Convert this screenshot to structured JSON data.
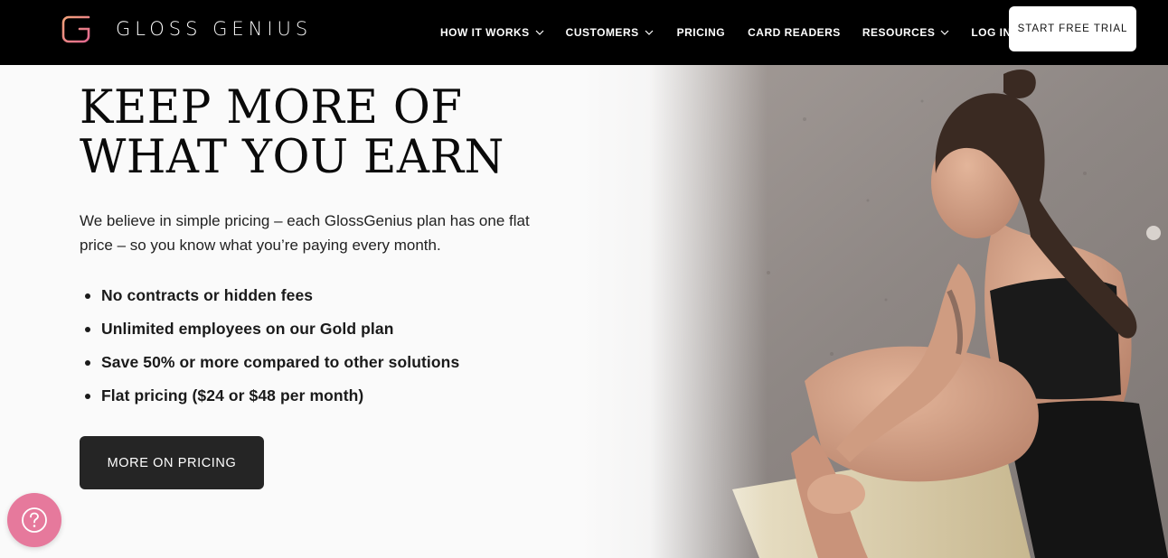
{
  "brand": {
    "name_part1": "GLOSS",
    "name_part2": "GENIUS",
    "logo_icon": "gloss-genius-logo-icon",
    "logo_gradient": [
      "#f2a27a",
      "#e2688f"
    ]
  },
  "nav": {
    "items": [
      {
        "label": "HOW IT WORKS",
        "has_dropdown": true
      },
      {
        "label": "CUSTOMERS",
        "has_dropdown": true
      },
      {
        "label": "PRICING",
        "has_dropdown": false
      },
      {
        "label": "CARD READERS",
        "has_dropdown": false
      },
      {
        "label": "RESOURCES",
        "has_dropdown": true
      },
      {
        "label": "LOG IN",
        "has_dropdown": false
      }
    ],
    "cta_label": "START FREE TRIAL"
  },
  "hero": {
    "headline_line1": "KEEP MORE OF",
    "headline_line2": "WHAT YOU EARN",
    "subtext": "We believe in simple pricing – each GlossGenius plan has one flat price – so you know what you’re paying every month.",
    "bullets": [
      "No contracts or hidden fees",
      "Unlimited employees on our Gold plan",
      "Save 50% or more compared to other solutions",
      "Flat pricing ($24 or $48 per month)"
    ],
    "button_label": "MORE ON PRICING",
    "image_icon": "woman-stretching-photo"
  },
  "help": {
    "icon": "question-mark-icon",
    "color": "#e6799c"
  },
  "colors": {
    "nav_bg": "#000000",
    "page_bg": "#fafafa",
    "button_dark": "#252525",
    "help_pink": "#e6799c"
  }
}
